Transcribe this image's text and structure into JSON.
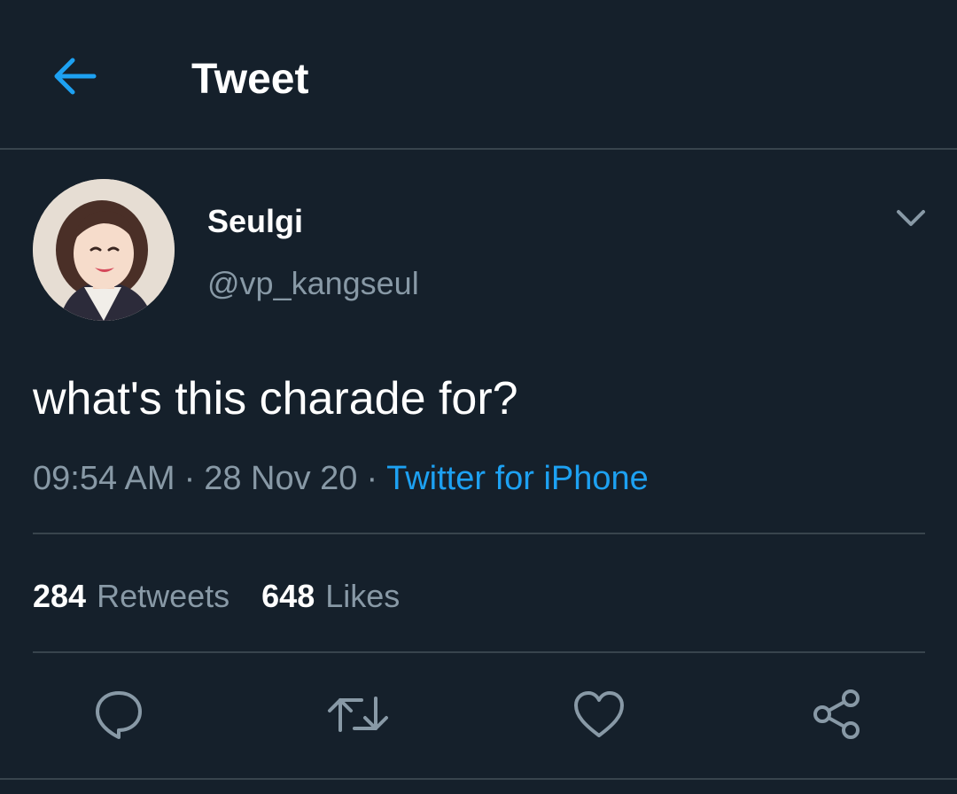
{
  "header": {
    "title": "Tweet",
    "back_icon": "arrow-left-icon"
  },
  "colors": {
    "background": "#15202b",
    "accent": "#1da1f2",
    "secondary_text": "#8899a6",
    "divider": "#38444d"
  },
  "tweet": {
    "author": {
      "display_name": "Seulgi",
      "handle": "@vp_kangseul",
      "avatar_icon": "profile-photo"
    },
    "more_icon": "chevron-down-icon",
    "text": "what's this charade for?",
    "time": "09:54 AM",
    "date": "28 Nov 20",
    "separator": "·",
    "source": "Twitter for iPhone"
  },
  "stats": {
    "retweets_count": "284",
    "retweets_label": "Retweets",
    "likes_count": "648",
    "likes_label": "Likes"
  },
  "actions": [
    {
      "name": "reply",
      "icon": "reply-icon"
    },
    {
      "name": "retweet",
      "icon": "retweet-icon"
    },
    {
      "name": "like",
      "icon": "heart-icon"
    },
    {
      "name": "share",
      "icon": "share-icon"
    }
  ]
}
